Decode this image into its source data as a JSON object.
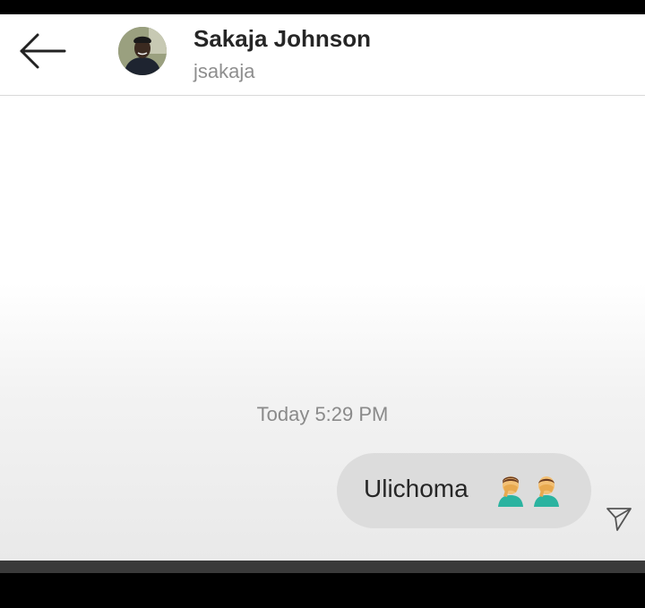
{
  "header": {
    "name": "Sakaja Johnson",
    "username": "jsakaja",
    "back_icon": "arrow-left-icon",
    "avatar": "profile-photo"
  },
  "conversation": {
    "timestamp": "Today 5:29 PM",
    "messages": [
      {
        "sender": "me",
        "text": "Ulichoma",
        "emojis": [
          "man-facepalming-emoji",
          "man-facepalming-emoji"
        ]
      }
    ]
  },
  "status_icon": "sent-paper-plane-icon",
  "colors": {
    "bubble": "#dcdcdc",
    "text": "#262626",
    "secondary_text": "#8e8e8e"
  }
}
